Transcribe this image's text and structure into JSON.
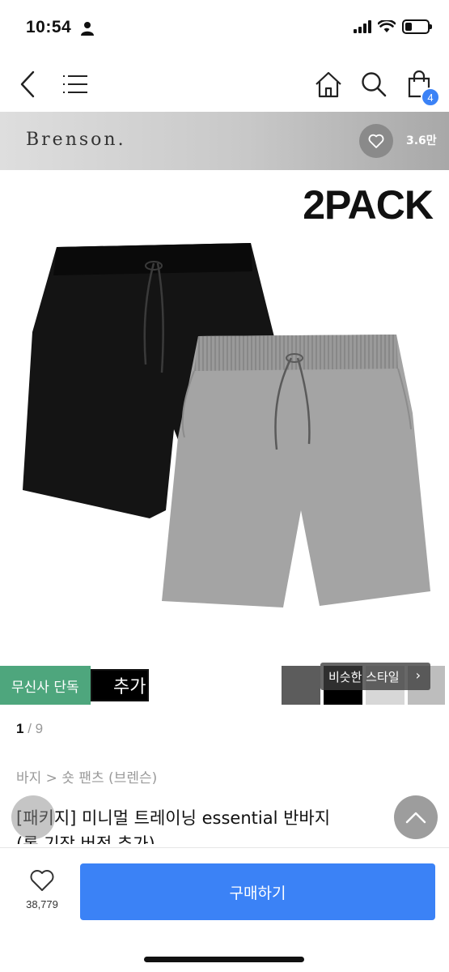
{
  "status_bar": {
    "time": "10:54"
  },
  "nav": {
    "cart_count": "4"
  },
  "brand": {
    "name": "Brenson.",
    "like_count": "3.6만"
  },
  "product_image": {
    "pack_label": "2PACK"
  },
  "thumbs": {
    "exclusive_badge": "무신사 단독",
    "option_text": "추가",
    "similar_style": "비슷한 스타일"
  },
  "pager": {
    "current": "1",
    "separator": " / ",
    "total": "9"
  },
  "breadcrumb": "바지 > 숏 팬츠 (브렌슨)",
  "product": {
    "title_line1": "[패키지] 미니멀 트레이닝 essential 반바지",
    "title_line2": "(롱 기장 버전 추가)"
  },
  "bottom_bar": {
    "like_count": "38,779",
    "buy_label": "구매하기"
  },
  "colors": {
    "accent": "#3b82f6",
    "exclusive": "#4ea67d"
  }
}
